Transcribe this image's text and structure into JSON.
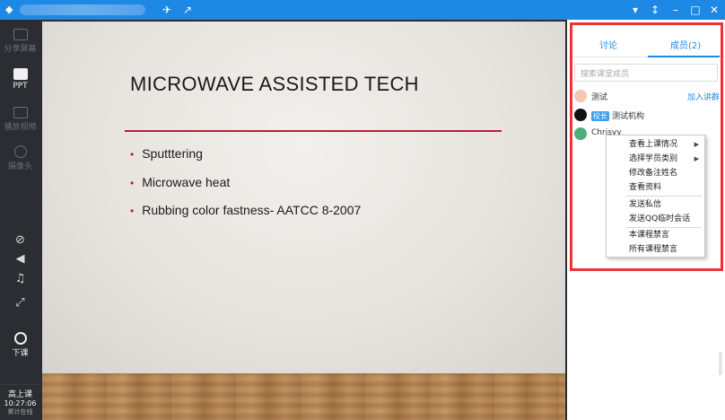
{
  "titlebar": {
    "bg_color": "#1e88e5"
  },
  "leftbar": {
    "items": [
      {
        "label": "分享屏幕",
        "icon": "share-screen-icon"
      },
      {
        "label": "PPT",
        "icon": "ppt-icon"
      },
      {
        "label": "播放视频",
        "icon": "play-video-icon"
      },
      {
        "label": "摄像头",
        "icon": "camera-icon"
      }
    ],
    "small_icons": [
      "mic-muted-icon",
      "speaker-icon",
      "music-icon",
      "fullscreen-icon"
    ],
    "end_class": {
      "label": "下课",
      "icon": "end-class-icon"
    },
    "footer": {
      "status": "高上课",
      "time": "10:27:06",
      "extra": "累计在线"
    }
  },
  "slide": {
    "title": "MICROWAVE ASSISTED TECH",
    "bullets": [
      "Sputttering",
      "Microwave heat",
      "Rubbing color fastness- AATCC 8-2007"
    ],
    "accent_color": "#b8203a"
  },
  "panel": {
    "tabs": [
      {
        "label": "讨论",
        "active": false
      },
      {
        "label": "成员(2)",
        "active": true
      }
    ],
    "search_placeholder": "搜索课堂成员",
    "members": [
      {
        "name": "测试",
        "badge": "",
        "action": "加入讲群"
      },
      {
        "name": "测试机构",
        "badge": "校长",
        "action": ""
      },
      {
        "name": "Chrisyy",
        "badge": "",
        "action": ""
      }
    ]
  },
  "context_menu": {
    "items": [
      {
        "label": "查看上课情况",
        "submenu": true
      },
      {
        "label": "选择学员类别",
        "submenu": true
      },
      {
        "label": "修改备注姓名",
        "submenu": false
      },
      {
        "label": "查看资料",
        "submenu": false
      },
      {
        "label": "发送私信",
        "submenu": false
      },
      {
        "label": "发送QQ临时会话",
        "submenu": false
      },
      {
        "label": "本课程禁言",
        "submenu": false
      },
      {
        "label": "所有课程禁言",
        "submenu": false
      }
    ]
  }
}
